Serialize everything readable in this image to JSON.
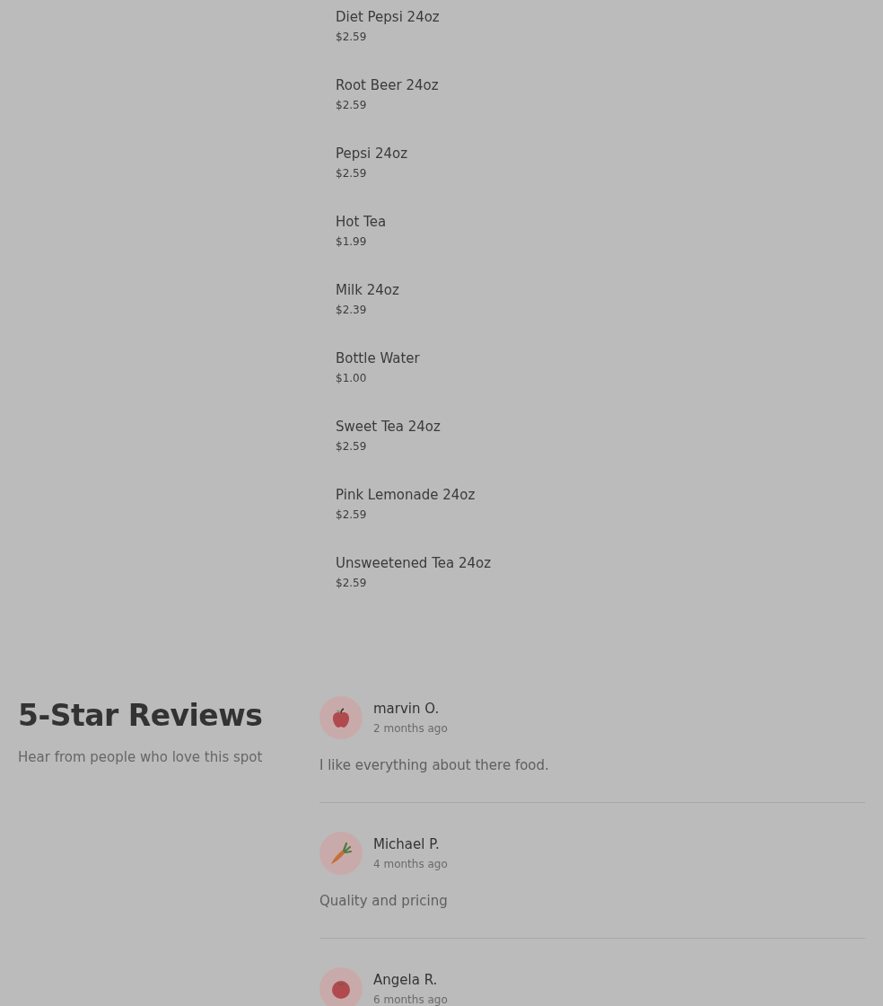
{
  "menu_items": [
    {
      "name": "Diet Pepsi 24oz",
      "price": "$2.59"
    },
    {
      "name": "Root Beer 24oz",
      "price": "$2.59"
    },
    {
      "name": "Pepsi 24oz",
      "price": "$2.59"
    },
    {
      "name": "Hot Tea",
      "price": "$1.99"
    },
    {
      "name": "Milk 24oz",
      "price": "$2.39"
    },
    {
      "name": "Bottle Water",
      "price": "$1.00"
    },
    {
      "name": "Sweet Tea 24oz",
      "price": "$2.59"
    },
    {
      "name": "Pink Lemonade 24oz",
      "price": "$2.59"
    },
    {
      "name": "Unsweetened Tea 24oz",
      "price": "$2.59"
    }
  ],
  "reviews_section": {
    "title": "5-Star Reviews",
    "subtitle": "Hear from people who love this spot",
    "reviews": [
      {
        "avatar": {
          "kind": "apple"
        },
        "name": "marvin O.",
        "time": "2 months ago",
        "text": "I like everything about there food."
      },
      {
        "avatar": {
          "kind": "carrot"
        },
        "name": "Michael P.",
        "time": "4 months ago",
        "text": "Quality and pricing"
      },
      {
        "avatar": {
          "kind": "tomato"
        },
        "name": "Angela R.",
        "time": "6 months ago"
      }
    ]
  }
}
